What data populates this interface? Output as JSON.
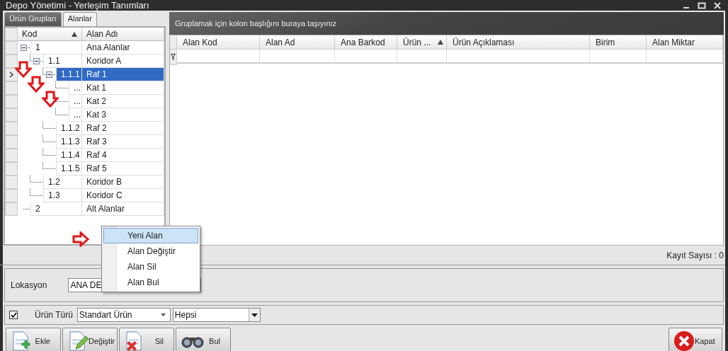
{
  "window": {
    "title": "Depo Yönetimi - Yerleşim Tanımları"
  },
  "tabs": [
    {
      "label": "Ürün Grupları",
      "selected": false
    },
    {
      "label": "Alanlar",
      "selected": true
    }
  ],
  "tree": {
    "columns": [
      {
        "label": "Kod",
        "sorted": true
      },
      {
        "label": "Alan Adı",
        "sorted": false
      }
    ],
    "rows": [
      {
        "code": "1",
        "name": "Ana Alanlar",
        "expanded": true,
        "selected": false,
        "children": [
          {
            "code": "1.1",
            "name": "Koridor A",
            "expanded": true,
            "selected": false,
            "children": [
              {
                "code": "1.1.1",
                "name": "Raf 1",
                "expanded": true,
                "selected": true,
                "children": [
                  {
                    "code": "...",
                    "name": "Kat 1",
                    "selected": false
                  },
                  {
                    "code": "...",
                    "name": "Kat 2",
                    "selected": false
                  },
                  {
                    "code": "...",
                    "name": "Kat 3",
                    "selected": false
                  }
                ]
              },
              {
                "code": "1.1.2",
                "name": "Raf 2",
                "selected": false
              },
              {
                "code": "1.1.3",
                "name": "Raf 3",
                "selected": false
              },
              {
                "code": "1.1.4",
                "name": "Raf 4",
                "selected": false
              },
              {
                "code": "1.1.5",
                "name": "Raf 5",
                "selected": false
              }
            ]
          },
          {
            "code": "1.2",
            "name": "Koridor B",
            "selected": false
          },
          {
            "code": "1.3",
            "name": "Koridor C",
            "selected": false
          }
        ]
      },
      {
        "code": "2",
        "name": "Alt Alanlar",
        "selected": false
      }
    ]
  },
  "group_panel": {
    "text": "Gruplamak için kolon başlığını buraya taşıyınız"
  },
  "grid": {
    "columns": [
      {
        "label": "Alan Kod",
        "sorted": false
      },
      {
        "label": "Alan Ad",
        "sorted": false
      },
      {
        "label": "Ana Barkod",
        "sorted": false
      },
      {
        "label": "Ürün ...",
        "sorted": true
      },
      {
        "label": "Ürün Açıklaması",
        "sorted": false
      },
      {
        "label": "Birim",
        "sorted": false
      },
      {
        "label": "Alan Miktar",
        "sorted": false
      }
    ]
  },
  "record_count": "Kayıt Sayısı : 0",
  "location": {
    "label": "Lokasyon",
    "value": "ANA DE"
  },
  "filter": {
    "checked": true,
    "label": "Ürün Türü",
    "type_value": "Standart Ürün",
    "scope_value": "Hepsi"
  },
  "buttons": [
    {
      "label": "Ekle",
      "kind": "add"
    },
    {
      "label": "Değiştir",
      "kind": "edit"
    },
    {
      "label": "Sil",
      "kind": "delete"
    },
    {
      "label": "Bul",
      "kind": "find"
    }
  ],
  "close_button": {
    "label": "Kapat"
  },
  "context_menu": [
    {
      "label": "Yeni Alan",
      "selected": true
    },
    {
      "label": "Alan Değiştir",
      "selected": false
    },
    {
      "label": "Alan Sil",
      "selected": false
    },
    {
      "label": "Alan Bul",
      "selected": false
    }
  ]
}
